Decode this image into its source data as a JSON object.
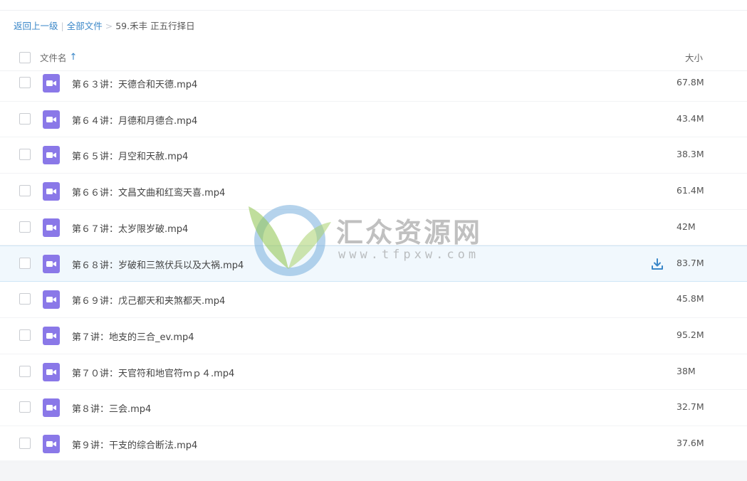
{
  "breadcrumb": {
    "back": "返回上一级",
    "separator": "|",
    "all_files": "全部文件",
    "arrow": ">",
    "current": "59.禾丰 正五行择日"
  },
  "table": {
    "name_header": "文件名",
    "sort_icon": "↑",
    "size_header": "大小"
  },
  "files": [
    {
      "name": "第６３讲：天德合和天德.mp4",
      "size": "67.8M"
    },
    {
      "name": "第６４讲：月德和月德合.mp4",
      "size": "43.4M"
    },
    {
      "name": "第６５讲：月空和天赦.mp4",
      "size": "38.3M"
    },
    {
      "name": "第６６讲：文昌文曲和红鸾天喜.mp4",
      "size": "61.4M"
    },
    {
      "name": "第６７讲：太岁限岁破.mp4",
      "size": "42M"
    },
    {
      "name": "第６８讲：岁破和三煞伏兵以及大祸.mp4",
      "size": "83.7M",
      "highlighted": true
    },
    {
      "name": "第６９讲：戊己都天和夹煞都天.mp4",
      "size": "45.8M"
    },
    {
      "name": "第７讲：地支的三合_ev.mp4",
      "size": "95.2M"
    },
    {
      "name": "第７０讲：天官符和地官符ｍｐ４.mp4",
      "size": "38M"
    },
    {
      "name": "第８讲：三会.mp4",
      "size": "32.7M"
    },
    {
      "name": "第９讲：干支的综合断法.mp4",
      "size": "37.6M"
    }
  ],
  "icons": {
    "file": "video-file-icon",
    "download": "download-icon",
    "checkbox": "checkbox"
  },
  "colors": {
    "accent": "#3a87c8",
    "video_icon": "#8a78e8",
    "highlight_row": "#f1f8fd"
  },
  "watermark": {
    "title": "汇众资源网",
    "url": "www.tfpxw.com"
  }
}
